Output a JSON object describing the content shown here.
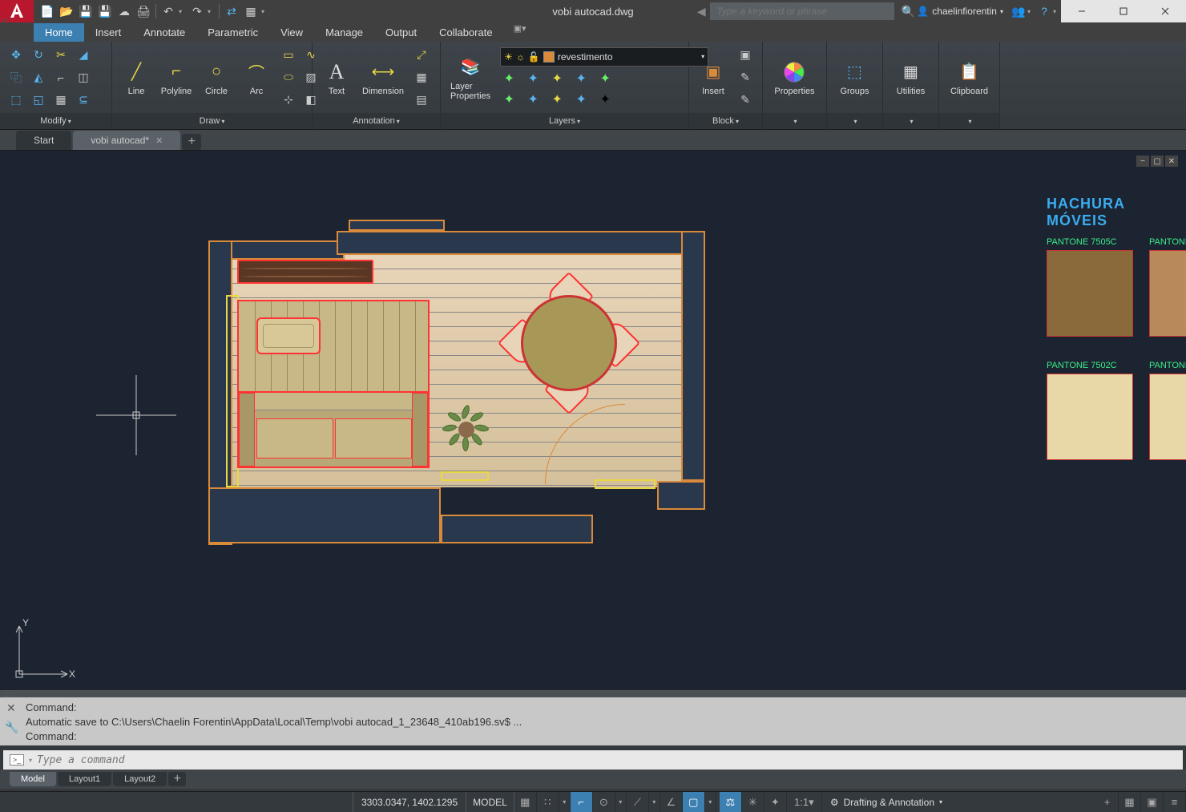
{
  "app": {
    "title": "vobi autocad.dwg",
    "search_placeholder": "Type a keyword or phrase",
    "user": "chaelinfiorentin"
  },
  "ribbon": {
    "tabs": [
      "Home",
      "Insert",
      "Annotate",
      "Parametric",
      "View",
      "Manage",
      "Output",
      "Collaborate"
    ],
    "panels": {
      "modify": "Modify",
      "draw": "Draw",
      "annotation": "Annotation",
      "layers": "Layers",
      "block": "Block",
      "properties": "Properties",
      "groups": "Groups",
      "utilities": "Utilities",
      "clipboard": "Clipboard"
    },
    "draw_btns": {
      "line": "Line",
      "polyline": "Polyline",
      "circle": "Circle",
      "arc": "Arc"
    },
    "annotation_btns": {
      "text": "Text",
      "dimension": "Dimension"
    },
    "layers_btn": "Layer Properties",
    "layer_selected": "revestimento",
    "insert_btn": "Insert",
    "properties_btn": "Properties",
    "groups_btn": "Groups",
    "utilities_btn": "Utilities",
    "clipboard_btn": "Clipboard"
  },
  "file_tabs": {
    "start": "Start",
    "current": "vobi autocad*"
  },
  "hachura": {
    "title": "HACHURA MÓVEIS",
    "swatches": [
      {
        "label": "PANTONE 7505C"
      },
      {
        "label": "PANTONE"
      },
      {
        "label": "PANTONE 7502C"
      },
      {
        "label": "PANTONE"
      }
    ]
  },
  "command": {
    "line1": "Command:",
    "line2": "Automatic save to C:\\Users\\Chaelin Forentin\\AppData\\Local\\Temp\\vobi autocad_1_23648_410ab196.sv$ ...",
    "line3": "Command:",
    "placeholder": "Type a command"
  },
  "layout_tabs": [
    "Model",
    "Layout1",
    "Layout2"
  ],
  "status": {
    "coords": "3303.0347, 1402.1295",
    "space": "MODEL",
    "scale": "1:1",
    "workspace": "Drafting & Annotation"
  }
}
